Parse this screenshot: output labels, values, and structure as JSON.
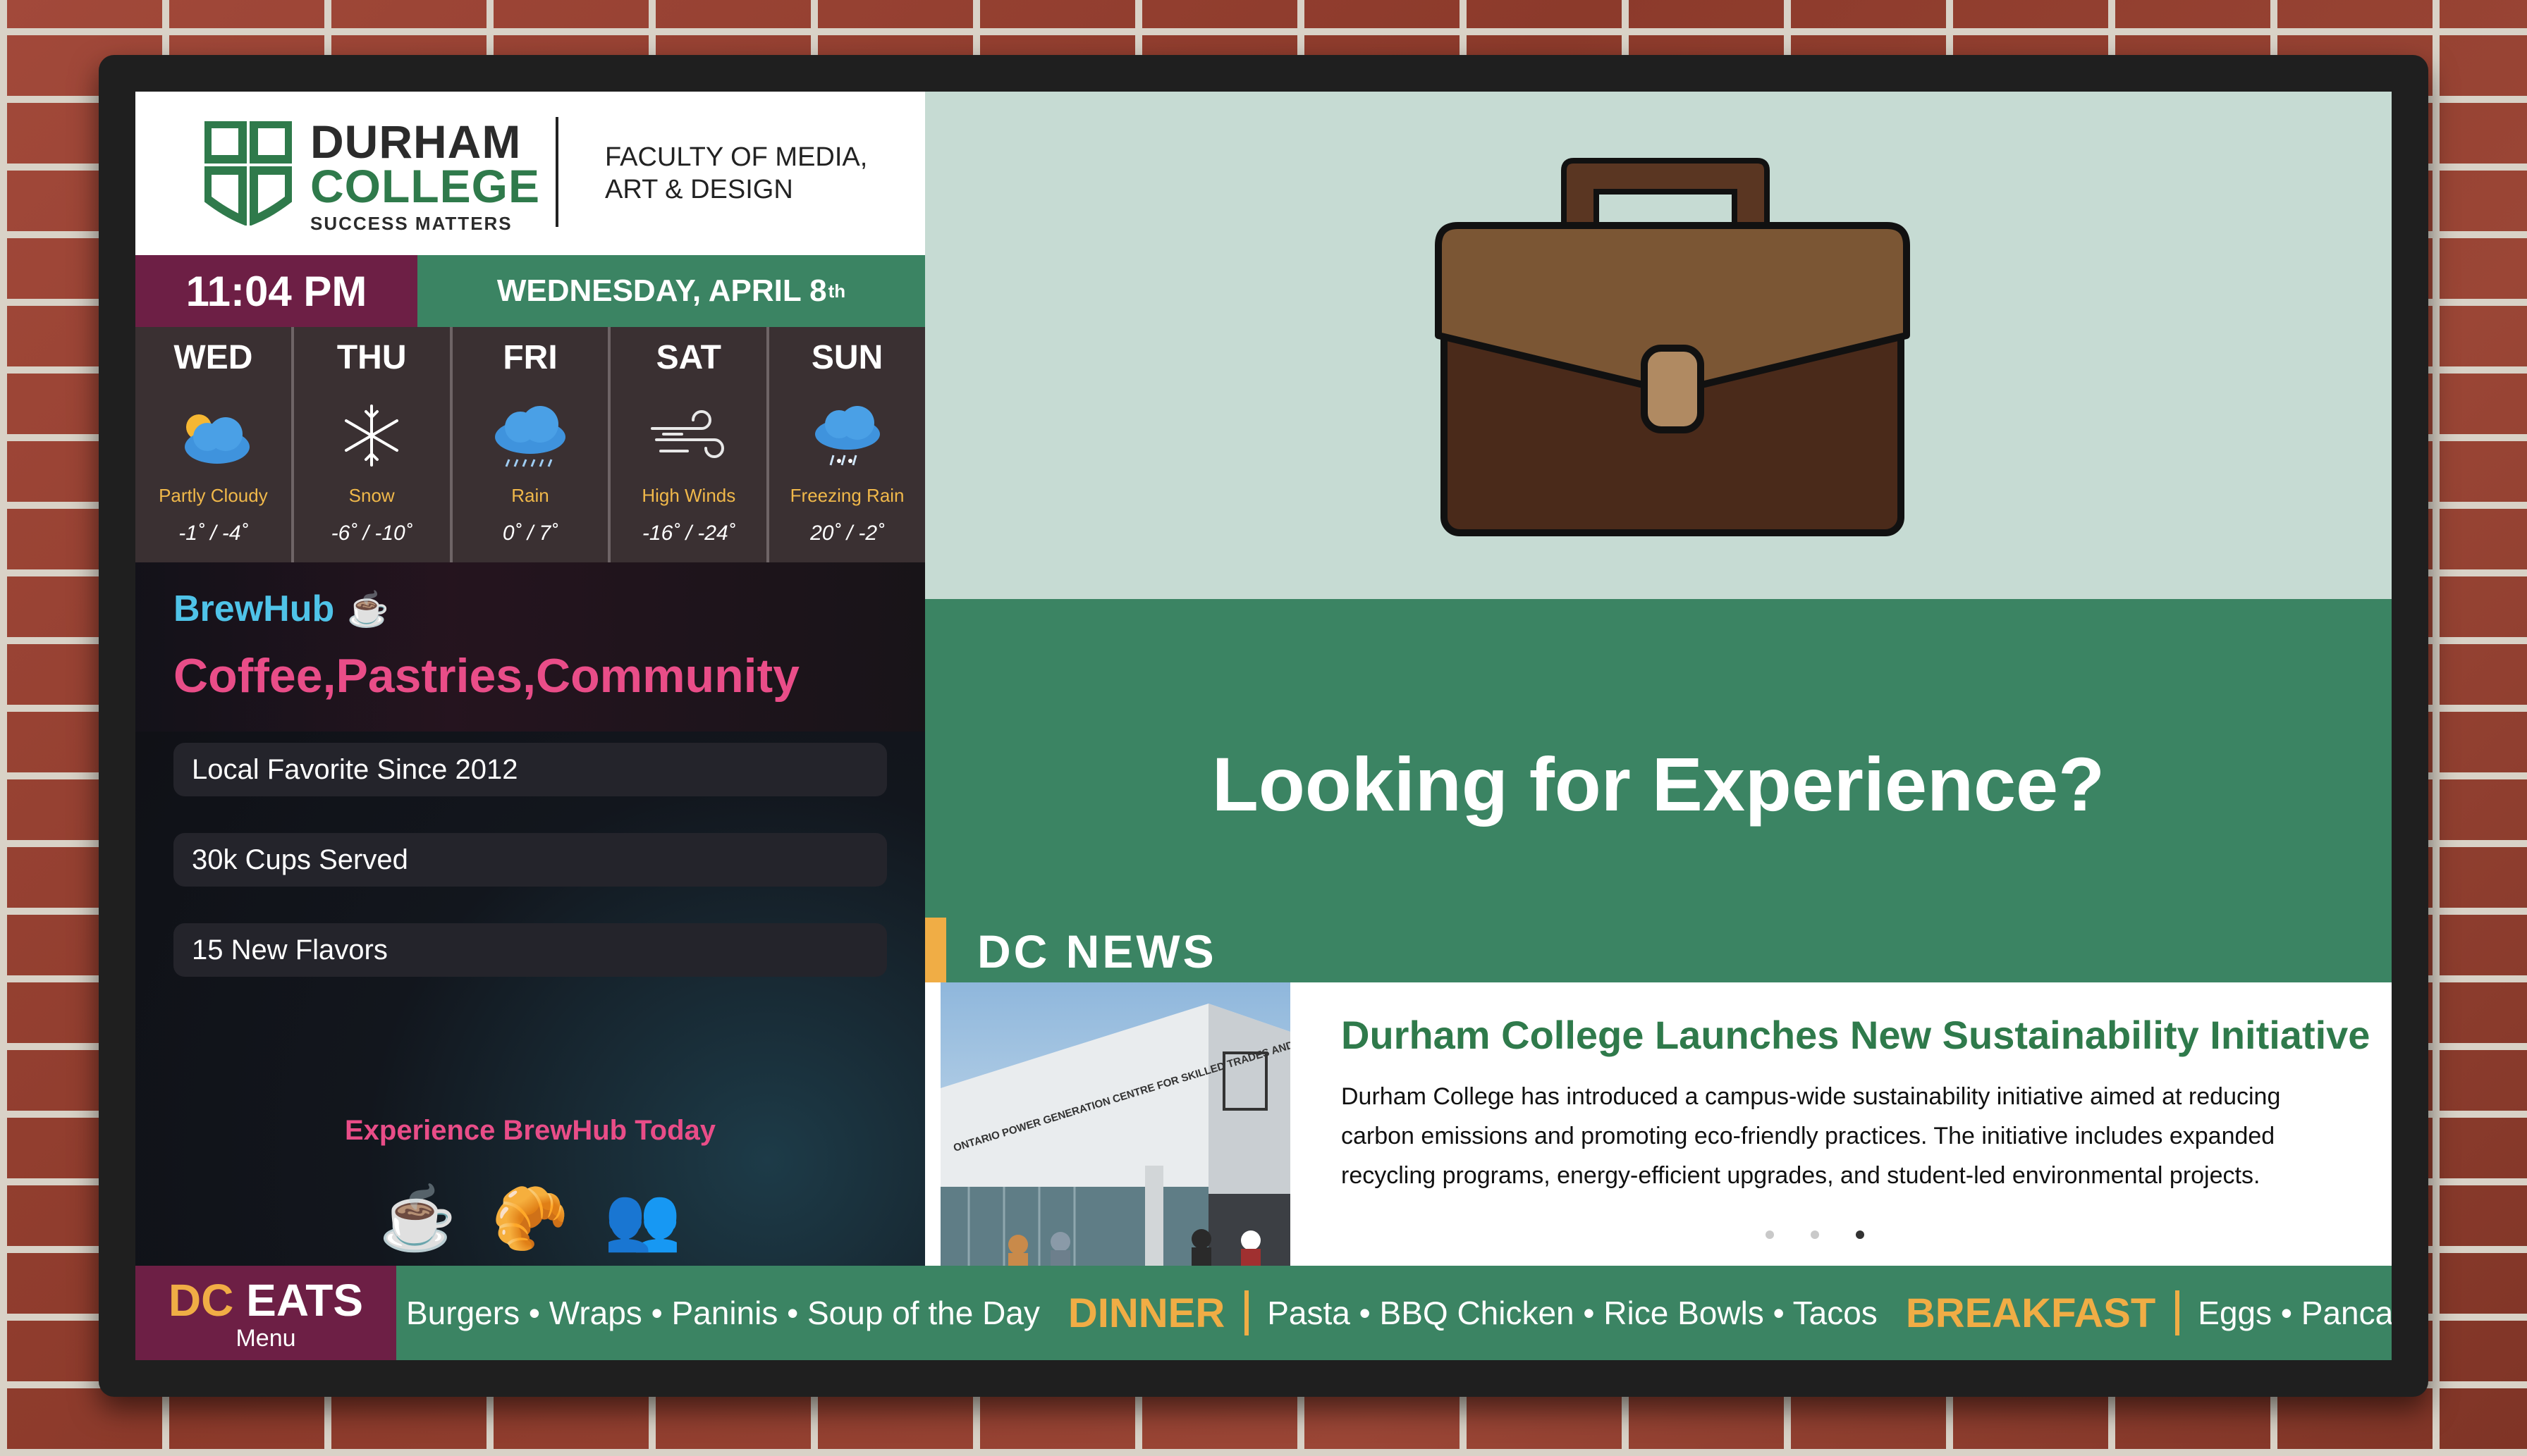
{
  "header": {
    "logo_line1": "DURHAM",
    "logo_line2": "COLLEGE",
    "logo_tagline": "SUCCESS MATTERS",
    "faculty_line1": "FACULTY OF MEDIA,",
    "faculty_line2": "ART & DESIGN"
  },
  "clock": {
    "time": "11:04 PM",
    "date": "WEDNESDAY, APRIL 8",
    "date_suffix": "th"
  },
  "weather": [
    {
      "day": "WED",
      "icon": "partly-cloudy-icon",
      "condition": "Partly Cloudy",
      "temps": "-1˚ / -4˚"
    },
    {
      "day": "THU",
      "icon": "snowflake-icon",
      "condition": "Snow",
      "temps": "-6˚ / -10˚"
    },
    {
      "day": "FRI",
      "icon": "rain-cloud-icon",
      "condition": "Rain",
      "temps": "0˚ / 7˚"
    },
    {
      "day": "SAT",
      "icon": "wind-icon",
      "condition": "High Winds",
      "temps": "-16˚ / -24˚"
    },
    {
      "day": "SUN",
      "icon": "freezing-rain-icon",
      "condition": "Freezing Rain",
      "temps": "20˚ / -2˚"
    }
  ],
  "brewhub": {
    "title": "BrewHub",
    "cup": "☕",
    "tagline": "Coffee,Pastries,Community",
    "items": [
      "Local Favorite Since 2012",
      "30k Cups Served",
      "15 New Flavors"
    ],
    "cta": "Experience BrewHub Today",
    "icons": [
      "☕",
      "🥐",
      "👥"
    ]
  },
  "hero": {
    "icon": "briefcase-icon",
    "banner_title": "Looking for Experience?",
    "colors": {
      "hero_bg": "#c6dbd3",
      "banner_bg": "#3b8463"
    }
  },
  "news": {
    "label": "DC NEWS",
    "title": "Durham College Launches New Sustainability Initiative",
    "body": "Durham College has introduced a campus-wide sustainability initiative aimed at reducing carbon emissions and promoting eco-friendly practices. The initiative includes expanded recycling programs, energy-efficient upgrades, and student-led environmental projects.",
    "photo_sign": "ONTARIO POWER GENERATION CENTRE FOR SKILLED TRADES AND TECHNOLOGY",
    "slides": 3,
    "active_slide": 3
  },
  "ticker": {
    "brand_dc": "DC",
    "brand_eats": "EATS",
    "brand_menu": "Menu",
    "lunch_items": "Burgers • Wraps • Paninis • Soup of the Day",
    "dinner_label": "DINNER",
    "dinner_items": "Pasta • BBQ Chicken • Rice Bowls • Tacos",
    "breakfast_label": "BREAKFAST",
    "breakfast_items": "Eggs • Pancakes"
  },
  "colors": {
    "maroon": "#6d1f45",
    "green": "#3b8463",
    "gold": "#f0ad45",
    "pink": "#e94d88",
    "cyan": "#4fc3e8"
  }
}
